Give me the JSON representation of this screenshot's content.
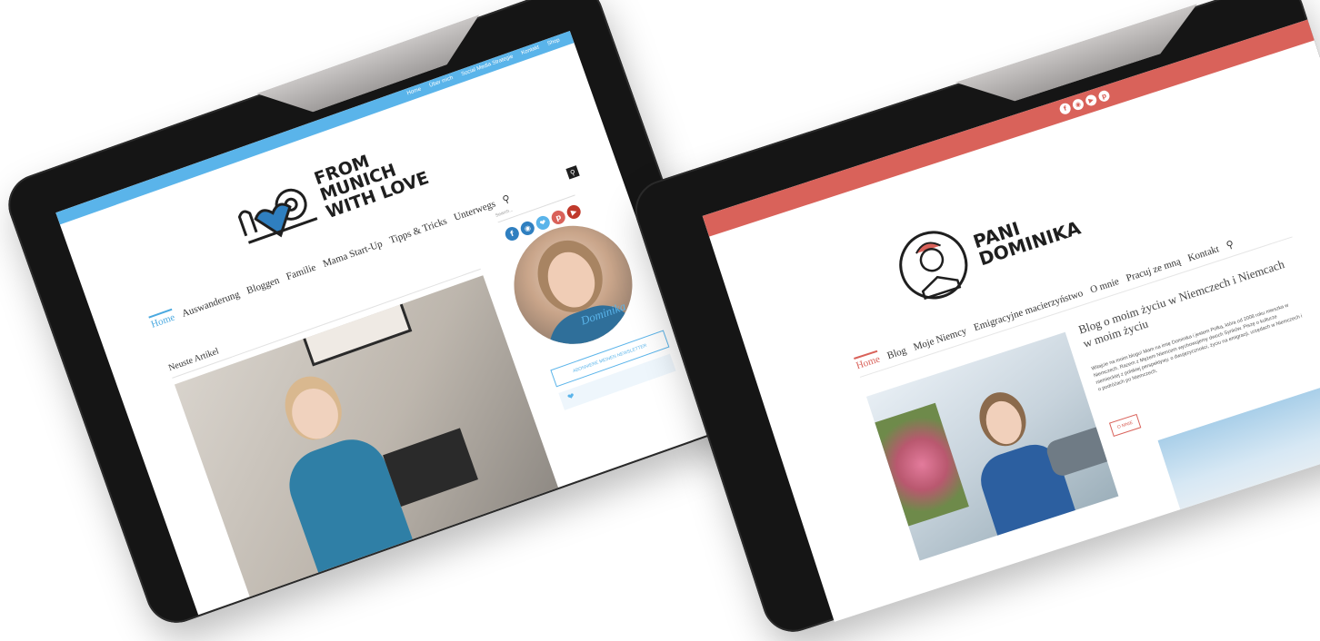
{
  "left_site": {
    "top_nav": [
      "Home",
      "Über mich",
      "Social Media Strategie",
      "Kontakt",
      "Shop"
    ],
    "logo_lines": [
      "FROM",
      "MUNICH",
      "WITH LOVE"
    ],
    "menu": [
      "Home",
      "Auswanderung",
      "Bloggen",
      "Familie",
      "Mama Start-Up",
      "Tipps & Tricks",
      "Unterwegs"
    ],
    "section_heading": "Neuste Artikel",
    "search_label": "Search...",
    "signature": "Dominika",
    "newsletter_button": "ABONNIERE MEINEN NEWSLETTER",
    "colors": {
      "accent": "#5ab4ea",
      "heart": "#2f7fc0"
    },
    "social_icons": [
      "facebook-icon",
      "instagram-icon",
      "twitter-icon",
      "pinterest-icon",
      "youtube-icon"
    ]
  },
  "right_site": {
    "logo_lines": [
      "PANI",
      "DOMINIKA"
    ],
    "menu": [
      "Home",
      "Blog",
      "Moje Niemcy",
      "Emigracyjne macierzyństwo",
      "O mnie",
      "Pracuj ze mną",
      "Kontakt"
    ],
    "article_title": "Blog o moim życiu w Niemczech i Niemcach w moim życiu",
    "article_body": "Witajcie na moim blogu! Mam na imię Dominika i jestem Polką, która od 2008 roku mieszka w Niemczech. Razem z Mężem Niemcem wychowujemy dwoch Synków. Piszę o kulturze niemieckiej z polskiej perspektywy, o dwujęzyczności, życiu na emigracji, urzędach w Niemczech i o podróżach po Niemczech.",
    "about_button": "O MNIE",
    "colors": {
      "accent": "#d9625a"
    },
    "social_icons": [
      "facebook-icon",
      "instagram-icon",
      "youtube-icon",
      "pinterest-icon"
    ]
  }
}
